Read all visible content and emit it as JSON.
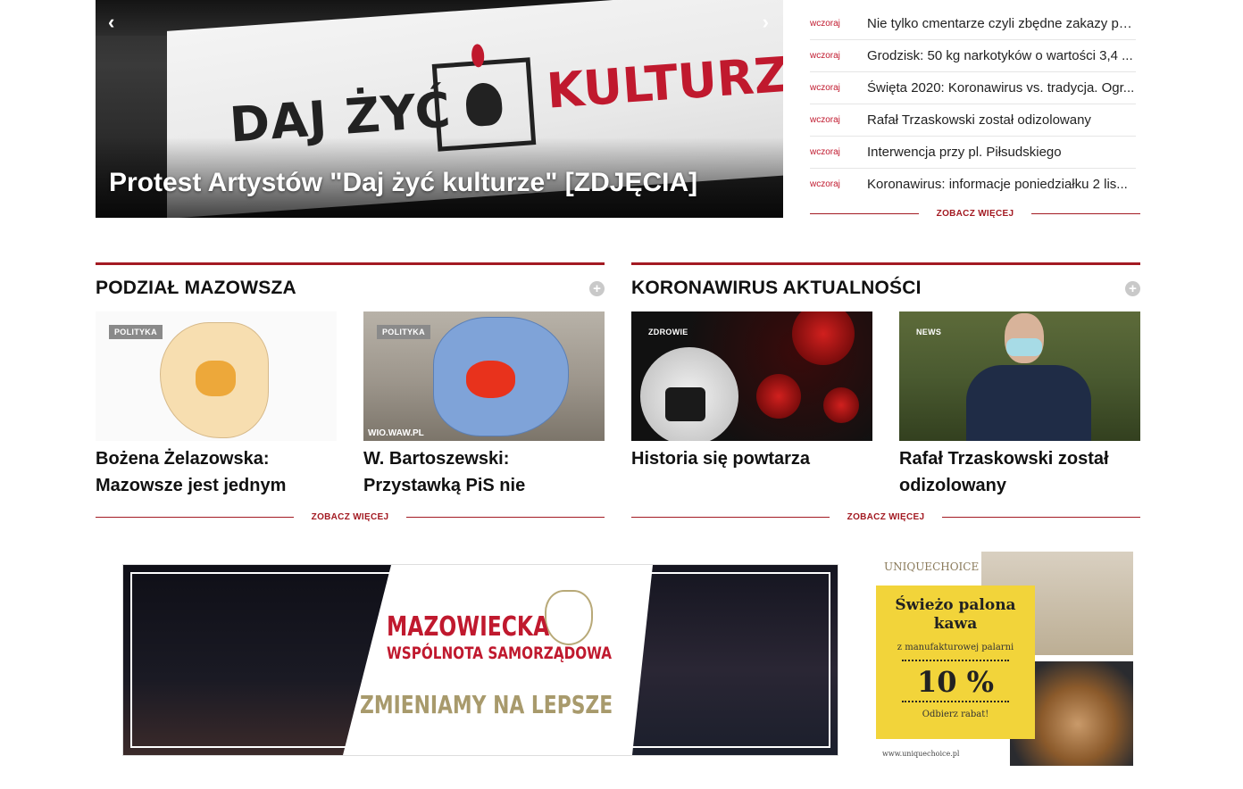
{
  "hero": {
    "title": "Protest Artystów \"Daj żyć kulturze\" [ZDJĘCIA]",
    "banner_text_left": "DAJ ŻYĆ",
    "banner_text_right": "KULTURZE",
    "prev_icon": "chevron-left-icon",
    "next_icon": "chevron-right-icon"
  },
  "latest": {
    "items": [
      {
        "when": "wczoraj",
        "title": "Nie tylko cmentarze czyli zbędne zakazy prem..."
      },
      {
        "when": "wczoraj",
        "title": "Grodzisk: 50 kg narkotyków o wartości 3,4 ..."
      },
      {
        "when": "wczoraj",
        "title": "Święta 2020: Koronawirus vs. tradycja. Ogr..."
      },
      {
        "when": "wczoraj",
        "title": "Rafał Trzaskowski został odizolowany"
      },
      {
        "when": "wczoraj",
        "title": "Interwencja przy pl. Piłsudskiego"
      },
      {
        "when": "wczoraj",
        "title": "Koronawirus: informacje poniedziałku 2 lis..."
      }
    ],
    "more_label": "ZOBACZ WIĘCEJ"
  },
  "sections": [
    {
      "title": "PODZIAŁ MAZOWSZA",
      "plus": "+",
      "more_label": "ZOBACZ WIĘCEJ",
      "cards": [
        {
          "tag": "POLITYKA",
          "title": "Bożena Żelazowska: Mazowsze jest jednym"
        },
        {
          "tag": "POLITYKA",
          "title": "W. Bartoszewski: Przystawką PiS nie będziemy. A na",
          "watermark": "WIO.WAW.PL"
        }
      ]
    },
    {
      "title": "KORONAWIRUS AKTUALNOŚCI",
      "plus": "+",
      "more_label": "ZOBACZ WIĘCEJ",
      "cards": [
        {
          "tag": "ZDROWIE",
          "title": "Historia się powtarza"
        },
        {
          "tag": "NEWS",
          "title": "Rafał Trzaskowski został odizolowany"
        }
      ]
    }
  ],
  "ad_mazowiecka": {
    "line1": "MAZOWIECKA",
    "line2": "WSPÓLNOTA SAMORZĄDOWA",
    "line3": "ZMIENIAMY NA LEPSZE"
  },
  "ad_coffee": {
    "brand": "UNIQUECHOICE",
    "headline1": "Świeżo palona",
    "headline2": "kawa",
    "subtitle": "z manufakturowej palarni",
    "discount": "10 %",
    "cta": "Odbierz rabat!",
    "url": "www.uniquechoice.pl"
  }
}
